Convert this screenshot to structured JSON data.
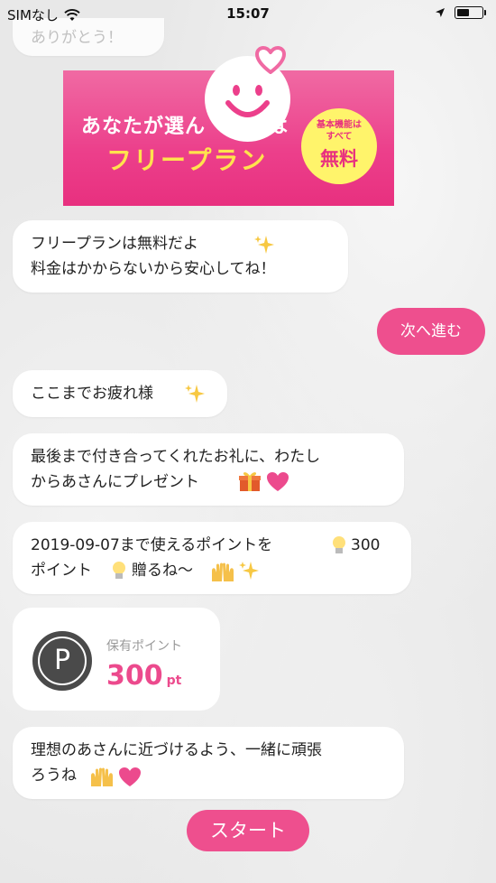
{
  "status_bar": {
    "carrier": "SIMなし",
    "time": "15:07",
    "battery_level": 0.5
  },
  "messages": {
    "top_partial": "ありがとう！",
    "free_plan": "フリープランは無料だよ\n料金はかからないから安心してね！",
    "thanks": "ここまでお疲れ様",
    "present": "最後まで付き合ってくれたお礼に、わたし\nからあさんにプレゼント",
    "points_gift": "2019-09-07まで使えるポイントを",
    "points_gift_amount": "300",
    "points_gift_line2a": "ポイント",
    "points_gift_line2b": "贈るね〜",
    "closing": "理想のあさんに近づけるよう、一緒に頑張\nろうね"
  },
  "banner": {
    "line1": "あなたが選ん　　　は",
    "line2": "フリープラン",
    "badge_small": "基本機能は\nすべて",
    "badge_large": "無料"
  },
  "buttons": {
    "next": "次へ進む",
    "start": "スタート"
  },
  "points_card": {
    "icon_letter": "P",
    "label": "保有ポイント",
    "value": "300",
    "unit": "pt"
  },
  "colors": {
    "accent": "#ee4f8e",
    "banner_pink": "#ec3f8b",
    "banner_yellow": "#ffe34d",
    "badge_yellow": "#fff46b"
  },
  "icons": {
    "sparkles": "sparkles-icon",
    "gift": "gift-icon",
    "heart": "heart-icon",
    "lightbulb": "lightbulb-icon",
    "raised_hands": "raised-hands-icon"
  }
}
